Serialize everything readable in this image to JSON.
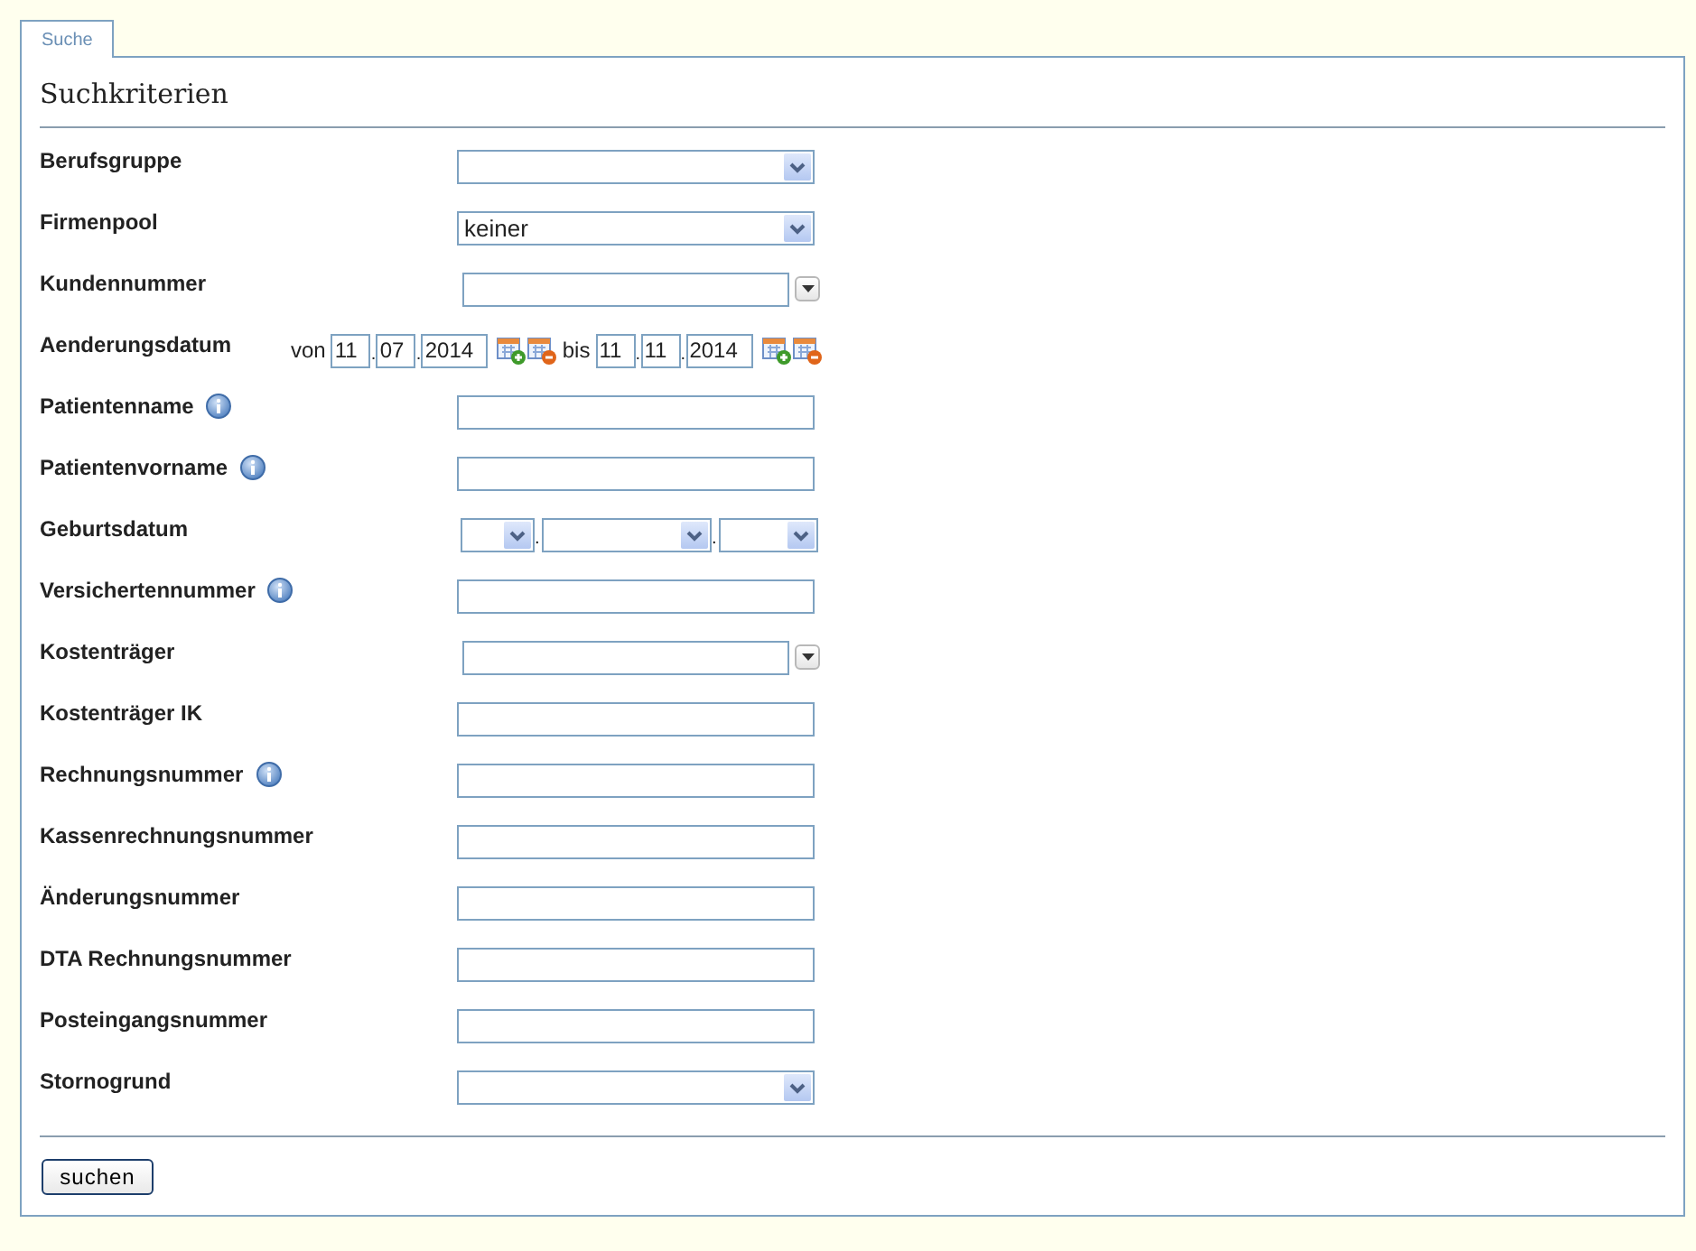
{
  "tab": {
    "label": "Suche",
    "selected": true
  },
  "title": "Suchkriterien",
  "fields": [
    {
      "kind": "select",
      "label": "Berufsgruppe"
    },
    {
      "kind": "select",
      "label": "Firmenpool",
      "value": "keiner"
    },
    {
      "kind": "combo",
      "label": "Kundennummer"
    },
    {
      "kind": "daterange",
      "label": "Aenderungsdatum",
      "separator": ".",
      "from_label": "von",
      "from": [
        "11",
        "07",
        "2014"
      ],
      "to_label": "bis",
      "to": [
        "11",
        "11",
        "2014"
      ]
    },
    {
      "kind": "text",
      "label": "Patientenname",
      "info": true
    },
    {
      "kind": "text",
      "label": "Patientenvorname",
      "info": true
    },
    {
      "kind": "dateselect",
      "label": "Geburtsdatum",
      "separator": "."
    },
    {
      "kind": "text",
      "label": "Versichertennummer",
      "info": true
    },
    {
      "kind": "combo",
      "label": "Kostenträger"
    },
    {
      "kind": "text",
      "label": "Kostenträger IK"
    },
    {
      "kind": "text",
      "label": "Rechnungsnummer",
      "info": true
    },
    {
      "kind": "text",
      "label": "Kassenrechnungsnummer"
    },
    {
      "kind": "text",
      "label": "Änderungsnummer"
    },
    {
      "kind": "text",
      "label": "DTA Rechnungsnummer"
    },
    {
      "kind": "text",
      "label": "Posteingangsnummer"
    },
    {
      "kind": "select",
      "label": "Stornogrund"
    }
  ],
  "button": "suchen"
}
